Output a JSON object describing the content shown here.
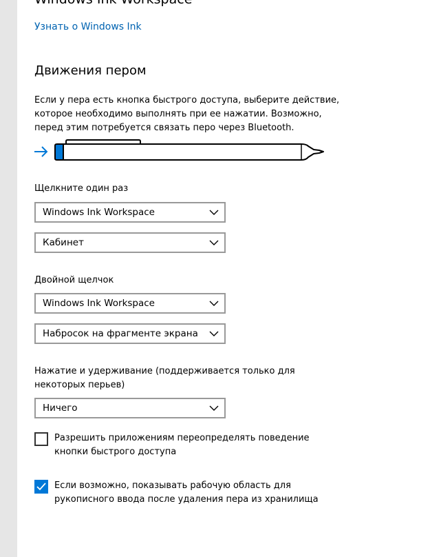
{
  "header": {
    "cut_title": "Windows Ink Workspace",
    "learn_link": "Узнать о Windows Ink"
  },
  "pen_shortcuts": {
    "title": "Движения пером",
    "description": "Если у пера есть кнопка быстрого доступа, выберите действие, которое необходимо выполнять при ее нажатии. Возможно, перед этим потребуется связать перо через Bluetooth.",
    "colors": {
      "accent": "#0078d7",
      "link": "#0063b1"
    },
    "click_once": {
      "label": "Щелкните один раз",
      "app_value": "Windows Ink Workspace",
      "action_value": "Кабинет"
    },
    "double_click": {
      "label": "Двойной щелчок",
      "app_value": "Windows Ink Workspace",
      "action_value": "Набросок на фрагменте экрана"
    },
    "press_hold": {
      "label": "Нажатие и удерживание (поддерживается только для некоторых перьев)",
      "value": "Ничего"
    },
    "override_checkbox": {
      "label": "Разрешить приложениям переопределять поведение кнопки быстрого доступа",
      "checked": false
    },
    "show_workspace_checkbox": {
      "label": "Если возможно, показывать рабочую область для рукописного ввода после удаления пера из хранилища",
      "checked": true
    }
  }
}
